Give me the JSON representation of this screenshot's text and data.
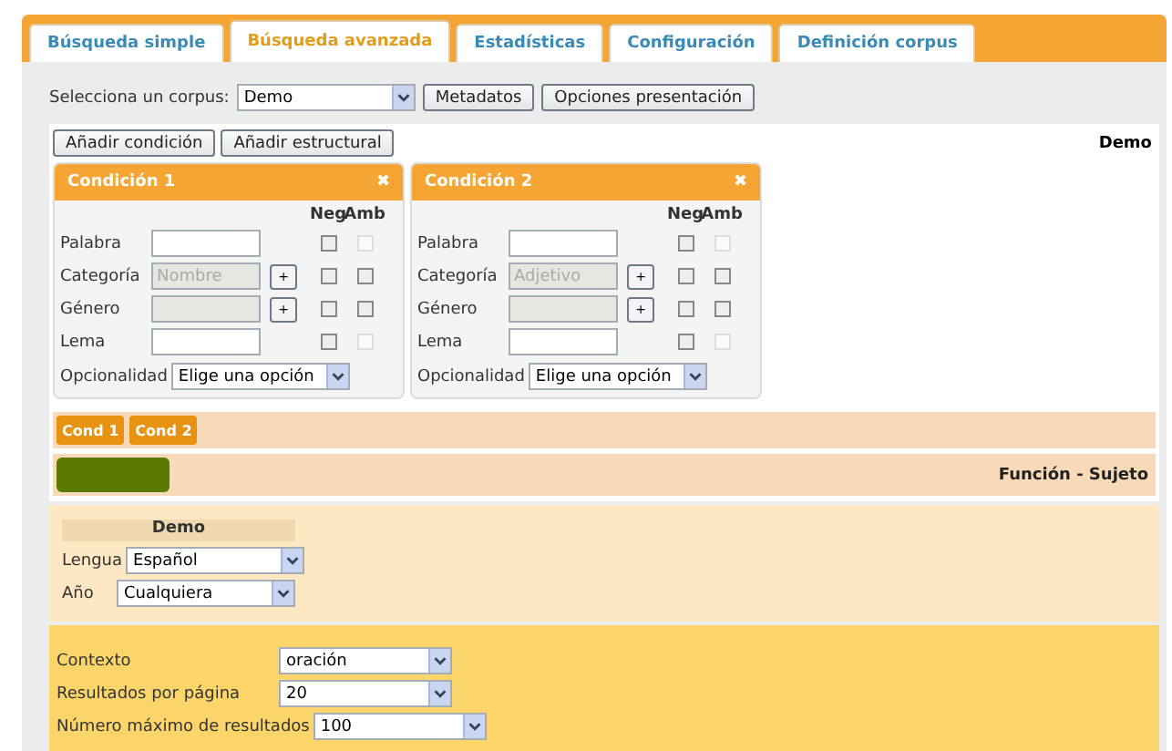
{
  "tabs": [
    {
      "label": "Búsqueda simple",
      "selected": false
    },
    {
      "label": "Búsqueda avanzada",
      "selected": true
    },
    {
      "label": "Estadísticas",
      "selected": false
    },
    {
      "label": "Configuración",
      "selected": false
    },
    {
      "label": "Definición corpus",
      "selected": false
    }
  ],
  "corpus": {
    "label": "Selecciona un corpus:",
    "value": "Demo",
    "buttons": [
      "Metadatos",
      "Opciones presentación"
    ]
  },
  "query": {
    "buttons": [
      "Añadir condición",
      "Añadir estructural"
    ],
    "corpus_name": "Demo",
    "conditions": [
      {
        "title": "Condición 1",
        "close": "✖",
        "neg_header": "Neg",
        "amb_header": "Amb",
        "rows": [
          {
            "label": "Palabra",
            "kind": "text",
            "neg": {
              "checked": false,
              "disabled": false
            },
            "amb": {
              "checked": false,
              "disabled": true
            }
          },
          {
            "label": "Categoría",
            "kind": "picker",
            "value": "Nombre",
            "button": "+",
            "neg": {
              "checked": false,
              "disabled": false
            },
            "amb": {
              "checked": false,
              "disabled": false
            }
          },
          {
            "label": "Género",
            "kind": "picker",
            "button": "+",
            "neg": {
              "checked": false,
              "disabled": false
            },
            "amb": {
              "checked": false,
              "disabled": false
            }
          },
          {
            "label": "Lema",
            "kind": "text",
            "neg": {
              "checked": false,
              "disabled": false
            },
            "amb": {
              "checked": false,
              "disabled": true
            }
          }
        ],
        "optional": {
          "label": "Opcionalidad",
          "value": "Elige una opción"
        }
      },
      {
        "title": "Condición 2",
        "close": "✖",
        "neg_header": "Neg",
        "amb_header": "Amb",
        "rows": [
          {
            "label": "Palabra",
            "kind": "text",
            "neg": {
              "checked": false,
              "disabled": false
            },
            "amb": {
              "checked": false,
              "disabled": true
            }
          },
          {
            "label": "Categoría",
            "kind": "picker",
            "value": "Adjetivo",
            "button": "+",
            "neg": {
              "checked": false,
              "disabled": false
            },
            "amb": {
              "checked": false,
              "disabled": false
            }
          },
          {
            "label": "Género",
            "kind": "picker",
            "button": "+",
            "neg": {
              "checked": false,
              "disabled": false
            },
            "amb": {
              "checked": false,
              "disabled": false
            }
          },
          {
            "label": "Lema",
            "kind": "text",
            "neg": {
              "checked": false,
              "disabled": false
            },
            "amb": {
              "checked": false,
              "disabled": true
            }
          }
        ],
        "optional": {
          "label": "Opcionalidad",
          "value": "Elige una opción"
        }
      }
    ],
    "chips": [
      "Cond 1",
      "Cond 2"
    ],
    "relation": {
      "label": "Función - Sujeto",
      "color": "#5a7a00"
    }
  },
  "metadata": {
    "title": "Demo",
    "fields": [
      {
        "label": "Lengua",
        "value": "Español"
      },
      {
        "label": "Año",
        "value": "Cualquiera"
      }
    ]
  },
  "options": [
    {
      "label": "Contexto",
      "value": "oración"
    },
    {
      "label": "Resultados por página",
      "value": "20"
    },
    {
      "label": "Número máximo de resultados",
      "value": "100"
    }
  ]
}
